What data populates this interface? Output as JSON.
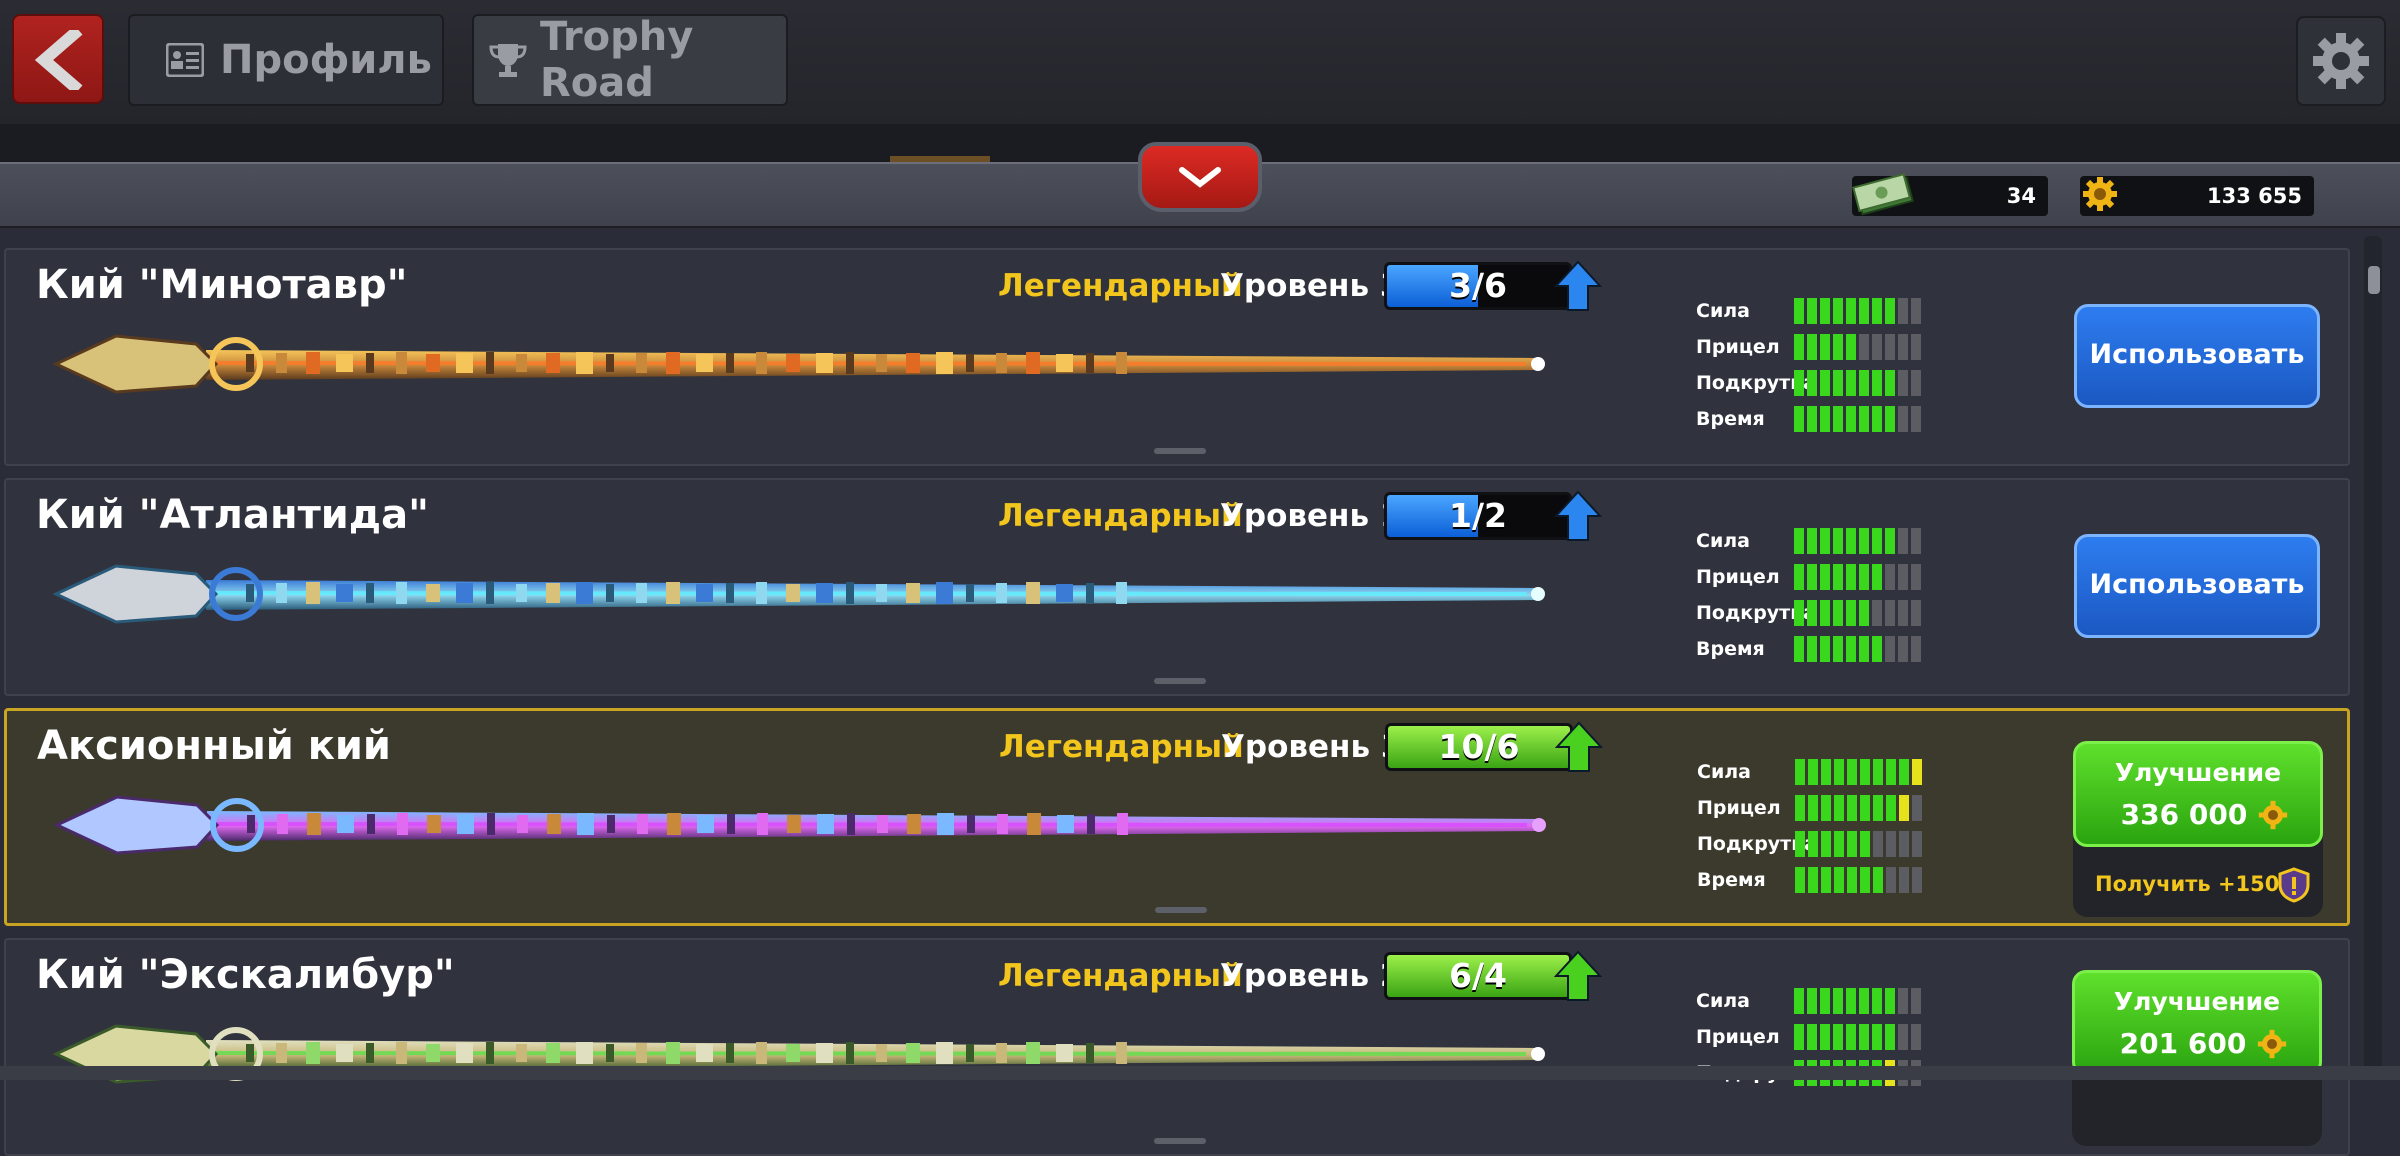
{
  "header": {
    "back_icon": "chevron-left-icon",
    "tabs": [
      {
        "label": "Профиль",
        "icon": "profile-card-icon"
      },
      {
        "label": "Trophy Road",
        "icon": "trophy-icon"
      }
    ],
    "settings_icon": "gear-icon"
  },
  "currency": {
    "cash": "34",
    "coins": "133 655"
  },
  "colors": {
    "accent_gold": "#f3c61e",
    "level_bar_blue": "#0c5fd6",
    "level_bar_green": "#3aa414",
    "use_button": "#1b58c2",
    "upgrade_button": "#2aa40f"
  },
  "cues": [
    {
      "name": "Кий \"Минотавр\"",
      "rarity": "Легендарный",
      "level": "Уровень 3",
      "progress_text": "3/6",
      "progress_fraction": 0.5,
      "progress_color": "blue",
      "stats": [
        {
          "label": "Сила",
          "value": 8,
          "yellow": false
        },
        {
          "label": "Прицел",
          "value": 5,
          "yellow": false
        },
        {
          "label": "Подкрутка",
          "value": 8,
          "yellow": false
        },
        {
          "label": "Время",
          "value": 8,
          "yellow": false
        }
      ],
      "action": "use",
      "action_label": "Использовать"
    },
    {
      "name": "Кий \"Атлантида\"",
      "rarity": "Легендарный",
      "level": "Уровень 1",
      "progress_text": "1/2",
      "progress_fraction": 0.5,
      "progress_color": "blue",
      "stats": [
        {
          "label": "Сила",
          "value": 8,
          "yellow": false
        },
        {
          "label": "Прицел",
          "value": 7,
          "yellow": false
        },
        {
          "label": "Подкрутка",
          "value": 6,
          "yellow": false
        },
        {
          "label": "Время",
          "value": 7,
          "yellow": false
        }
      ],
      "action": "use",
      "action_label": "Использовать"
    },
    {
      "name": "Аксионный кий",
      "rarity": "Легендарный",
      "level": "Уровень 3",
      "progress_text": "10/6",
      "progress_fraction": 1.0,
      "progress_color": "green",
      "stats": [
        {
          "label": "Сила",
          "value": 9,
          "yellow": true
        },
        {
          "label": "Прицел",
          "value": 8,
          "yellow": true
        },
        {
          "label": "Подкрутка",
          "value": 6,
          "yellow": false
        },
        {
          "label": "Время",
          "value": 7,
          "yellow": false
        }
      ],
      "action": "upgrade",
      "action_label": "Улучшение",
      "price": "336 000",
      "bonus": "Получить +150"
    },
    {
      "name": "Кий \"Экскалибур\"",
      "rarity": "Легендарный",
      "level": "Уровень 2",
      "progress_text": "6/4",
      "progress_fraction": 1.0,
      "progress_color": "green",
      "stats": [
        {
          "label": "Сила",
          "value": 8,
          "yellow": false
        },
        {
          "label": "Прицел",
          "value": 8,
          "yellow": false
        },
        {
          "label": "Подкрутка",
          "value": 7,
          "yellow": true
        }
      ],
      "action": "upgrade",
      "action_label": "Улучшение",
      "price": "201 600"
    }
  ]
}
